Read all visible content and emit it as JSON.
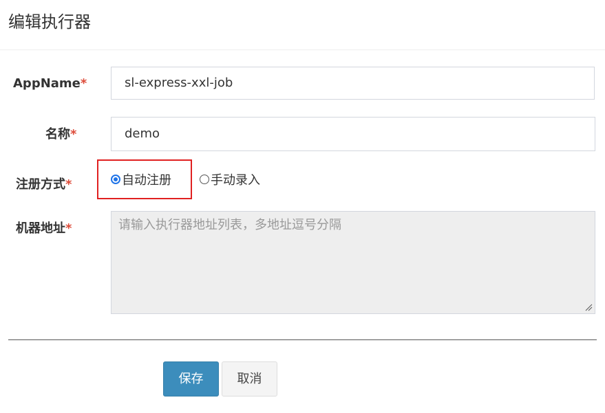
{
  "dialog": {
    "title": "编辑执行器"
  },
  "form": {
    "appname": {
      "label": "AppName",
      "required_mark": "*",
      "value": "sl-express-xxl-job"
    },
    "name": {
      "label": "名称",
      "required_mark": "*",
      "value": "demo"
    },
    "register_type": {
      "label": "注册方式",
      "required_mark": "*",
      "options": [
        {
          "label": "自动注册",
          "checked": true
        },
        {
          "label": "手动录入",
          "checked": false
        }
      ]
    },
    "address": {
      "label": "机器地址",
      "required_mark": "*",
      "placeholder": "请输入执行器地址列表，多地址逗号分隔",
      "value": ""
    }
  },
  "footer": {
    "save_label": "保存",
    "cancel_label": "取消"
  },
  "colors": {
    "primary": "#3c8dbc",
    "required": "#dd4b39",
    "highlight": "#e02020",
    "radio_checked": "#1e73e8"
  }
}
